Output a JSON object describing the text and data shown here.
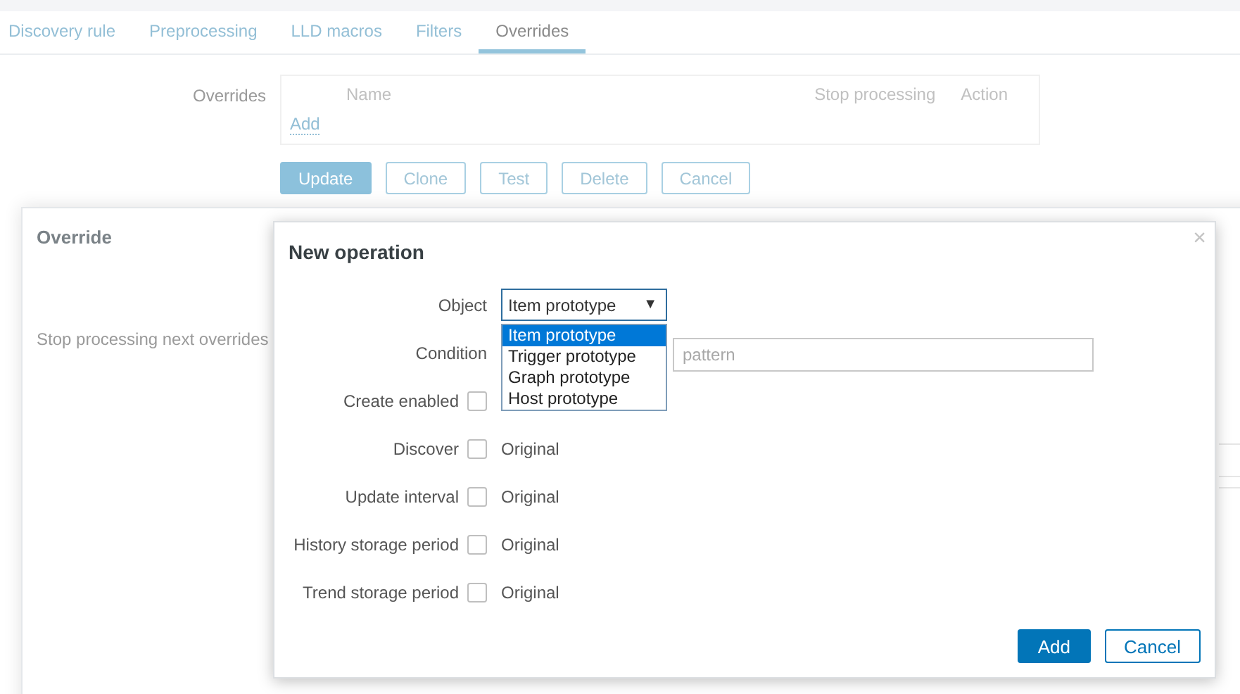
{
  "tabs": [
    {
      "label": "Discovery rule",
      "selected": false
    },
    {
      "label": "Preprocessing",
      "selected": false
    },
    {
      "label": "LLD macros",
      "selected": false
    },
    {
      "label": "Filters",
      "selected": false
    },
    {
      "label": "Overrides",
      "selected": true
    }
  ],
  "overrides_form": {
    "label": "Overrides",
    "columns": [
      "Name",
      "Stop processing",
      "Action"
    ],
    "add_link": "Add"
  },
  "form_buttons": [
    {
      "label": "Update",
      "primary": true
    },
    {
      "label": "Clone",
      "primary": false
    },
    {
      "label": "Test",
      "primary": false
    },
    {
      "label": "Delete",
      "primary": false
    },
    {
      "label": "Cancel",
      "primary": false
    }
  ],
  "override_dialog": {
    "title": "Override",
    "field_label": "Stop processing next overrides"
  },
  "operation_dialog": {
    "title": "New operation",
    "close": "×",
    "object": {
      "label": "Object",
      "value": "Item prototype",
      "caret": "▼",
      "expanded": true,
      "options": [
        {
          "label": "Item prototype",
          "selected": true
        },
        {
          "label": "Trigger prototype",
          "selected": false
        },
        {
          "label": "Graph prototype",
          "selected": false
        },
        {
          "label": "Host prototype",
          "selected": false
        }
      ]
    },
    "condition": {
      "label": "Condition",
      "placeholder": "pattern"
    },
    "rows": [
      {
        "label": "Create enabled",
        "checked": false
      },
      {
        "label": "Discover",
        "checked": false,
        "value": "Original"
      },
      {
        "label": "Update interval",
        "checked": false,
        "value": "Original"
      },
      {
        "label": "History storage period",
        "checked": false,
        "value": "Original"
      },
      {
        "label": "Trend storage period",
        "checked": false,
        "value": "Original"
      }
    ],
    "buttons": [
      {
        "label": "Add",
        "primary": true
      },
      {
        "label": "Cancel",
        "primary": false
      }
    ]
  }
}
